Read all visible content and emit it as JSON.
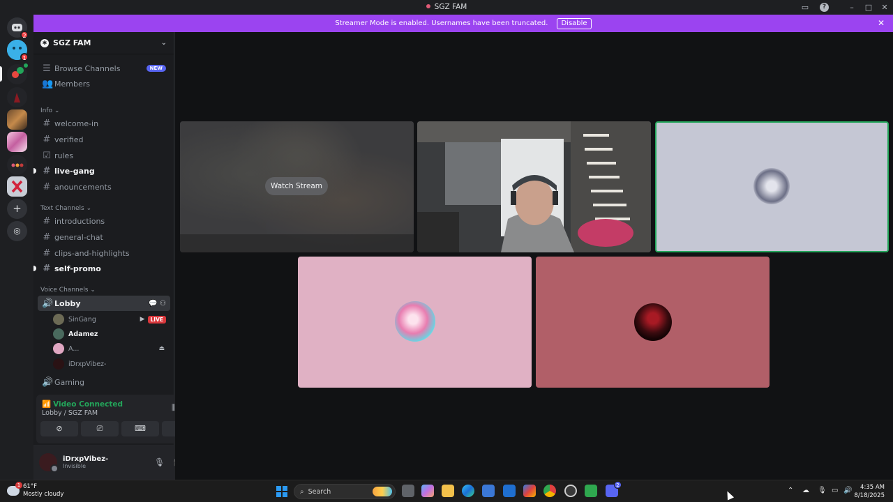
{
  "window": {
    "title": "SGZ FAM"
  },
  "rail": {
    "dm_badge": "2",
    "server2_badge": "1",
    "server3_badge": "1"
  },
  "banner": {
    "text": "Streamer Mode is enabled. Usernames have been truncated.",
    "button": "Disable"
  },
  "server": {
    "name": "SGZ FAM"
  },
  "nav": {
    "browse": "Browse Channels",
    "browse_badge": "NEW",
    "members": "Members"
  },
  "categories": {
    "info": "Info",
    "text": "Text Channels",
    "voice": "Voice Channels"
  },
  "info_channels": [
    "welcome-in",
    "verified",
    "rules",
    "live-gang",
    "anouncements"
  ],
  "text_channels": [
    "introductions",
    "general-chat",
    "clips-and-highlights",
    "self-promo"
  ],
  "voice": {
    "lobby": "Lobby",
    "users": [
      {
        "name": "SinGang",
        "live": "LIVE"
      },
      {
        "name": "Adamez"
      },
      {
        "name": "A..."
      },
      {
        "name": "iDrxpVibez-"
      }
    ],
    "gaming": "Gaming"
  },
  "voice_panel": {
    "status": "Video Connected",
    "location": "Lobby / SGZ FAM"
  },
  "user": {
    "name": "iDrxpVibez-",
    "status": "Invisible"
  },
  "stage": {
    "watch_label": "Watch Stream"
  },
  "taskbar": {
    "temp": "61°F",
    "weather": "Mostly cloudy",
    "weather_badge": "1",
    "search": "Search",
    "discord_badge": "2",
    "time": "4:35 AM",
    "date": "8/18/2025"
  },
  "colors": {
    "accent": "#9b44f0",
    "connected": "#23a55a",
    "live": "#da373c",
    "blurple": "#5865f2"
  }
}
